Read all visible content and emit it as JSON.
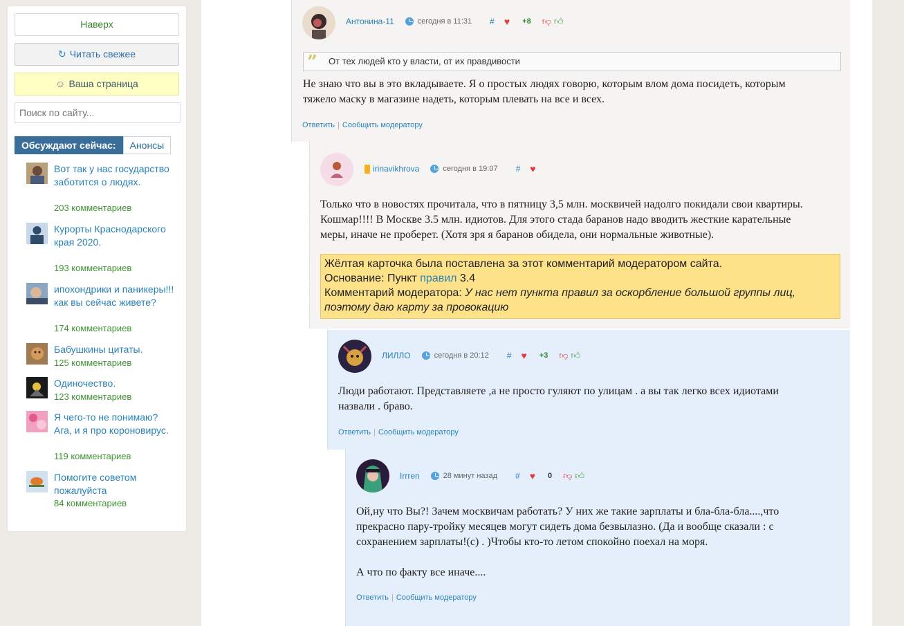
{
  "sidebar": {
    "up_label": "Наверх",
    "fresh_label": "Читать свежее",
    "mypage_label": "Ваша страница",
    "search_placeholder": "Поиск по сайту...",
    "tabs": [
      {
        "label": "Обсуждают сейчас:",
        "active": true
      },
      {
        "label": "Анонсы",
        "active": false
      }
    ],
    "topics": [
      {
        "title": "Вот так у нас государство заботится о людях.",
        "count": "203 комментариев"
      },
      {
        "title": "Курорты Краснодарского края 2020.",
        "count": "193 комментариев"
      },
      {
        "title": "ипохондрики и паникеры!!! как вы сейчас живете?",
        "count": "174 комментариев"
      },
      {
        "title": "Бабушкины цитаты.",
        "count": "125 комментариев"
      },
      {
        "title": "Одиночество.",
        "count": "123 комментариев"
      },
      {
        "title": "Я чего-то не понимаю? Ага, и я про короновирус.",
        "count": "119 комментариев"
      },
      {
        "title": "Помогите советом пожалуйста",
        "count": "84 комментариев"
      }
    ]
  },
  "comments": [
    {
      "author": "Антонина-11",
      "time": "сегодня в 11:31",
      "hash": "#",
      "score": "+8",
      "quote": "От тех людей кто у власти, от их правдивости",
      "text_lines": [
        "Не знаю что вы в это вкладываете. Я о простых людях говорю, которым влом дома посидеть, которым",
        "тяжело маску в магазине надеть, которым плевать на все и всех."
      ],
      "reply": "Ответить",
      "report": "Сообщить модератору"
    },
    {
      "author": "irinavikhrova",
      "time": "сегодня в 19:07",
      "hash": "#",
      "text_lines": [
        "Только что в новостях прочитала, что в пятницу 3,5 млн. москвичей надолго покидали свои квартиры.",
        "Кошмар!!!! В Москве 3.5 млн. идиотов. Для этого стада баранов надо вводить жесткие карательные",
        "меры, иначе не проберет. (Хотя зря я баранов обидела, они нормальные животные)."
      ],
      "moderation": {
        "line1": "Жёлтая карточка была поставлена за этот комментарий модератором сайта.",
        "basis_prefix": "Основание: Пункт ",
        "basis_link": "правил",
        "basis_suffix": " 3.4",
        "comment_prefix": "Комментарий модератора: ",
        "comment_line1": "У нас нет пункта правил за оскорбление большой группы лиц,",
        "comment_line2": "поэтому даю карту за провокацию"
      }
    },
    {
      "author": "ЛИЛЛО",
      "time": "сегодня в 20:12",
      "hash": "#",
      "score": "+3",
      "text_lines": [
        "Люди работают. Представляете ,а не просто гуляют по улицам . а вы так легко всех идиотами",
        "назвали . браво."
      ],
      "reply": "Ответить",
      "report": "Сообщить модератору"
    },
    {
      "author": "Irrren",
      "time": "28 минут назад",
      "hash": "#",
      "score": "0",
      "text_lines": [
        "Ой,ну что Вы?! Зачем москвичам работать? У них же такие зарплаты и бла-бла-бла....,что",
        "прекрасно пару-тройку месяцев могут сидеть дома безвылазно. (Да и вообще сказали : с",
        "сохранением зарплаты!(с) . )Чтобы кто-то летом спокойно поехал на моря.",
        "",
        "А что по факту все иначе...."
      ],
      "reply": "Ответить",
      "report": "Сообщить модератору"
    }
  ]
}
